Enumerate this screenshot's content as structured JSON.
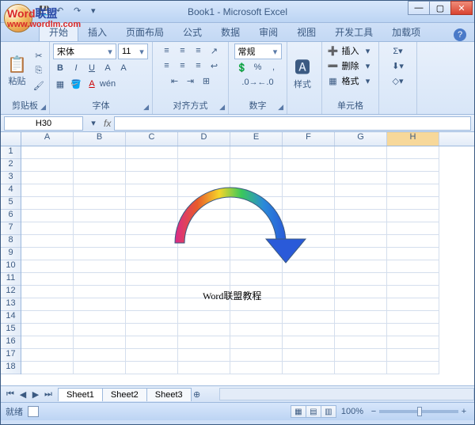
{
  "watermark": {
    "text1": "Word",
    "text2": "联盟",
    "url": "www.wordlm.com"
  },
  "title": "Book1 - Microsoft Excel",
  "tabs": [
    "开始",
    "插入",
    "页面布局",
    "公式",
    "数据",
    "审阅",
    "视图",
    "开发工具",
    "加载项"
  ],
  "active_tab": 0,
  "ribbon": {
    "clipboard": {
      "label": "剪贴板",
      "paste": "粘贴"
    },
    "font": {
      "label": "字体",
      "name": "宋体",
      "size": "11"
    },
    "align": {
      "label": "对齐方式"
    },
    "number": {
      "label": "数字",
      "format": "常规"
    },
    "styles": {
      "label": "样式"
    },
    "cells": {
      "label": "单元格",
      "insert": "插入",
      "delete": "删除",
      "format": "格式"
    },
    "editing": {
      "label": ""
    }
  },
  "namebox": "H30",
  "columns": [
    "A",
    "B",
    "C",
    "D",
    "E",
    "F",
    "G",
    "H"
  ],
  "selected_col": "H",
  "row_count": 18,
  "cell_text": "Word联盟教程",
  "sheets": [
    "Sheet1",
    "Sheet2",
    "Sheet3"
  ],
  "active_sheet": 0,
  "status": {
    "ready": "就绪",
    "zoom": "100%"
  }
}
